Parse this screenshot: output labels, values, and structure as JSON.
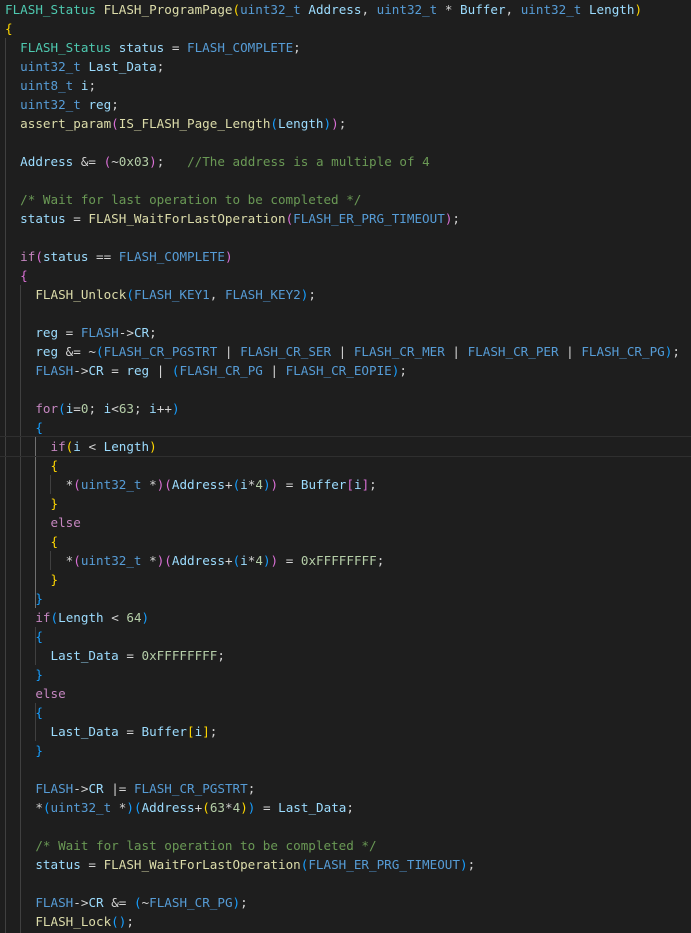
{
  "editor": {
    "theme": "dark",
    "background": "#1e1e1e",
    "current_line": 23,
    "colors": {
      "type": "#4ec9b0",
      "function": "#dcdcaa",
      "variable": "#9cdcfe",
      "keyword": "#c586c0",
      "macro": "#569cd6",
      "number": "#b5cea8",
      "comment": "#6a9955",
      "bracket_1": "#ffd700",
      "bracket_2": "#da70d6",
      "bracket_3": "#179fff"
    }
  },
  "lines": [
    [
      [
        "FLASH_Status",
        "type"
      ],
      [
        " ",
        ""
      ],
      [
        "FLASH_ProgramPage",
        "fn"
      ],
      [
        "(",
        "b1"
      ],
      [
        "uint32_t",
        "mac"
      ],
      [
        " ",
        ""
      ],
      [
        "Address",
        "var"
      ],
      [
        ", ",
        ""
      ],
      [
        "uint32_t",
        "mac"
      ],
      [
        " * ",
        ""
      ],
      [
        "Buffer",
        "var"
      ],
      [
        ", ",
        ""
      ],
      [
        "uint32_t",
        "mac"
      ],
      [
        " ",
        ""
      ],
      [
        "Length",
        "var"
      ],
      [
        ")",
        "b1"
      ]
    ],
    [
      [
        "{",
        "b1"
      ]
    ],
    [
      [
        "  ",
        ""
      ],
      [
        "FLASH_Status",
        "type"
      ],
      [
        " ",
        ""
      ],
      [
        "status",
        "var"
      ],
      [
        " = ",
        ""
      ],
      [
        "FLASH_COMPLETE",
        "mac"
      ],
      [
        ";",
        ""
      ]
    ],
    [
      [
        "  ",
        ""
      ],
      [
        "uint32_t",
        "mac"
      ],
      [
        " ",
        ""
      ],
      [
        "Last_Data",
        "var"
      ],
      [
        ";",
        ""
      ]
    ],
    [
      [
        "  ",
        ""
      ],
      [
        "uint8_t",
        "mac"
      ],
      [
        " ",
        ""
      ],
      [
        "i",
        "var"
      ],
      [
        ";",
        ""
      ]
    ],
    [
      [
        "  ",
        ""
      ],
      [
        "uint32_t",
        "mac"
      ],
      [
        " ",
        ""
      ],
      [
        "reg",
        "var"
      ],
      [
        ";",
        ""
      ]
    ],
    [
      [
        "  ",
        ""
      ],
      [
        "assert_param",
        "fn"
      ],
      [
        "(",
        "b2"
      ],
      [
        "IS_FLASH_Page_Length",
        "fn"
      ],
      [
        "(",
        "b3"
      ],
      [
        "Length",
        "var"
      ],
      [
        ")",
        "b3"
      ],
      [
        ")",
        "b2"
      ],
      [
        ";",
        ""
      ]
    ],
    [],
    [
      [
        "  ",
        ""
      ],
      [
        "Address",
        "var"
      ],
      [
        " &= ",
        ""
      ],
      [
        "(",
        "b2"
      ],
      [
        "~",
        "op"
      ],
      [
        "0x03",
        "num"
      ],
      [
        ")",
        "b2"
      ],
      [
        ";   ",
        ""
      ],
      [
        "//The address is a multiple of 4",
        "com"
      ]
    ],
    [],
    [
      [
        "  ",
        ""
      ],
      [
        "/* Wait for last operation to be completed */",
        "com"
      ]
    ],
    [
      [
        "  ",
        ""
      ],
      [
        "status",
        "var"
      ],
      [
        " = ",
        ""
      ],
      [
        "FLASH_WaitForLastOperation",
        "fn"
      ],
      [
        "(",
        "b2"
      ],
      [
        "FLASH_ER_PRG_TIMEOUT",
        "mac"
      ],
      [
        ")",
        "b2"
      ],
      [
        ";",
        ""
      ]
    ],
    [],
    [
      [
        "  ",
        ""
      ],
      [
        "if",
        "kw"
      ],
      [
        "(",
        "b2"
      ],
      [
        "status",
        "var"
      ],
      [
        " == ",
        ""
      ],
      [
        "FLASH_COMPLETE",
        "mac"
      ],
      [
        ")",
        "b2"
      ]
    ],
    [
      [
        "  ",
        ""
      ],
      [
        "{",
        "b2"
      ]
    ],
    [
      [
        "    ",
        ""
      ],
      [
        "FLASH_Unlock",
        "fn"
      ],
      [
        "(",
        "b3"
      ],
      [
        "FLASH_KEY1",
        "mac"
      ],
      [
        ", ",
        ""
      ],
      [
        "FLASH_KEY2",
        "mac"
      ],
      [
        ")",
        "b3"
      ],
      [
        ";",
        ""
      ]
    ],
    [],
    [
      [
        "    ",
        ""
      ],
      [
        "reg",
        "var"
      ],
      [
        " = ",
        ""
      ],
      [
        "FLASH",
        "mac"
      ],
      [
        "->",
        "op"
      ],
      [
        "CR",
        "var"
      ],
      [
        ";",
        ""
      ]
    ],
    [
      [
        "    ",
        ""
      ],
      [
        "reg",
        "var"
      ],
      [
        " &= ~",
        ""
      ],
      [
        "(",
        "b3"
      ],
      [
        "FLASH_CR_PGSTRT",
        "mac"
      ],
      [
        " | ",
        ""
      ],
      [
        "FLASH_CR_SER",
        "mac"
      ],
      [
        " | ",
        ""
      ],
      [
        "FLASH_CR_MER",
        "mac"
      ],
      [
        " | ",
        ""
      ],
      [
        "FLASH_CR_PER",
        "mac"
      ],
      [
        " | ",
        ""
      ],
      [
        "FLASH_CR_PG",
        "mac"
      ],
      [
        ")",
        "b3"
      ],
      [
        ";",
        ""
      ]
    ],
    [
      [
        "    ",
        ""
      ],
      [
        "FLASH",
        "mac"
      ],
      [
        "->",
        "op"
      ],
      [
        "CR",
        "var"
      ],
      [
        " = ",
        ""
      ],
      [
        "reg",
        "var"
      ],
      [
        " | ",
        ""
      ],
      [
        "(",
        "b3"
      ],
      [
        "FLASH_CR_PG",
        "mac"
      ],
      [
        " | ",
        ""
      ],
      [
        "FLASH_CR_EOPIE",
        "mac"
      ],
      [
        ")",
        "b3"
      ],
      [
        ";",
        ""
      ]
    ],
    [],
    [
      [
        "    ",
        ""
      ],
      [
        "for",
        "kw"
      ],
      [
        "(",
        "b3"
      ],
      [
        "i",
        "var"
      ],
      [
        "=",
        ""
      ],
      [
        "0",
        "num"
      ],
      [
        "; ",
        ""
      ],
      [
        "i",
        "var"
      ],
      [
        "<",
        ""
      ],
      [
        "63",
        "num"
      ],
      [
        "; ",
        ""
      ],
      [
        "i",
        "var"
      ],
      [
        "++",
        ""
      ],
      [
        ")",
        "b3"
      ]
    ],
    [
      [
        "    ",
        ""
      ],
      [
        "{",
        "b3"
      ]
    ],
    [
      [
        "      ",
        ""
      ],
      [
        "if",
        "kw"
      ],
      [
        "(",
        "b1"
      ],
      [
        "i",
        "var"
      ],
      [
        " < ",
        ""
      ],
      [
        "Length",
        "var"
      ],
      [
        ")",
        "b1"
      ]
    ],
    [
      [
        "      ",
        ""
      ],
      [
        "{",
        "b1"
      ]
    ],
    [
      [
        "        ",
        ""
      ],
      [
        "*",
        "op"
      ],
      [
        "(",
        "b2"
      ],
      [
        "uint32_t",
        "mac"
      ],
      [
        " *",
        ""
      ],
      [
        ")",
        "b2"
      ],
      [
        "(",
        "b2"
      ],
      [
        "Address",
        "var"
      ],
      [
        "+",
        ""
      ],
      [
        "(",
        "b3"
      ],
      [
        "i",
        "var"
      ],
      [
        "*",
        ""
      ],
      [
        "4",
        "num"
      ],
      [
        ")",
        "b3"
      ],
      [
        ")",
        "b2"
      ],
      [
        " = ",
        ""
      ],
      [
        "Buffer",
        "var"
      ],
      [
        "[",
        "b2"
      ],
      [
        "i",
        "var"
      ],
      [
        "]",
        "b2"
      ],
      [
        ";",
        ""
      ]
    ],
    [
      [
        "      ",
        ""
      ],
      [
        "}",
        "b1"
      ]
    ],
    [
      [
        "      ",
        ""
      ],
      [
        "else",
        "kw"
      ]
    ],
    [
      [
        "      ",
        ""
      ],
      [
        "{",
        "b1"
      ]
    ],
    [
      [
        "        ",
        ""
      ],
      [
        "*",
        "op"
      ],
      [
        "(",
        "b2"
      ],
      [
        "uint32_t",
        "mac"
      ],
      [
        " *",
        ""
      ],
      [
        ")",
        "b2"
      ],
      [
        "(",
        "b2"
      ],
      [
        "Address",
        "var"
      ],
      [
        "+",
        ""
      ],
      [
        "(",
        "b3"
      ],
      [
        "i",
        "var"
      ],
      [
        "*",
        ""
      ],
      [
        "4",
        "num"
      ],
      [
        ")",
        "b3"
      ],
      [
        ")",
        "b2"
      ],
      [
        " = ",
        ""
      ],
      [
        "0xFFFFFFFF",
        "num"
      ],
      [
        ";",
        ""
      ]
    ],
    [
      [
        "      ",
        ""
      ],
      [
        "}",
        "b1"
      ]
    ],
    [
      [
        "    ",
        ""
      ],
      [
        "}",
        "b3"
      ]
    ],
    [
      [
        "    ",
        ""
      ],
      [
        "if",
        "kw"
      ],
      [
        "(",
        "b3"
      ],
      [
        "Length",
        "var"
      ],
      [
        " < ",
        ""
      ],
      [
        "64",
        "num"
      ],
      [
        ")",
        "b3"
      ]
    ],
    [
      [
        "    ",
        ""
      ],
      [
        "{",
        "b3"
      ]
    ],
    [
      [
        "      ",
        ""
      ],
      [
        "Last_Data",
        "var"
      ],
      [
        " = ",
        ""
      ],
      [
        "0xFFFFFFFF",
        "num"
      ],
      [
        ";",
        ""
      ]
    ],
    [
      [
        "    ",
        ""
      ],
      [
        "}",
        "b3"
      ]
    ],
    [
      [
        "    ",
        ""
      ],
      [
        "else",
        "kw"
      ]
    ],
    [
      [
        "    ",
        ""
      ],
      [
        "{",
        "b3"
      ]
    ],
    [
      [
        "      ",
        ""
      ],
      [
        "Last_Data",
        "var"
      ],
      [
        " = ",
        ""
      ],
      [
        "Buffer",
        "var"
      ],
      [
        "[",
        "b1"
      ],
      [
        "i",
        "var"
      ],
      [
        "]",
        "b1"
      ],
      [
        ";",
        ""
      ]
    ],
    [
      [
        "    ",
        ""
      ],
      [
        "}",
        "b3"
      ]
    ],
    [],
    [
      [
        "    ",
        ""
      ],
      [
        "FLASH",
        "mac"
      ],
      [
        "->",
        "op"
      ],
      [
        "CR",
        "var"
      ],
      [
        " |= ",
        ""
      ],
      [
        "FLASH_CR_PGSTRT",
        "mac"
      ],
      [
        ";",
        ""
      ]
    ],
    [
      [
        "    ",
        ""
      ],
      [
        "*",
        "op"
      ],
      [
        "(",
        "b3"
      ],
      [
        "uint32_t",
        "mac"
      ],
      [
        " *",
        ""
      ],
      [
        ")",
        "b3"
      ],
      [
        "(",
        "b3"
      ],
      [
        "Address",
        "var"
      ],
      [
        "+",
        ""
      ],
      [
        "(",
        "b1"
      ],
      [
        "63",
        "num"
      ],
      [
        "*",
        ""
      ],
      [
        "4",
        "num"
      ],
      [
        ")",
        "b1"
      ],
      [
        ")",
        "b3"
      ],
      [
        " = ",
        ""
      ],
      [
        "Last_Data",
        "var"
      ],
      [
        ";",
        ""
      ]
    ],
    [],
    [
      [
        "    ",
        ""
      ],
      [
        "/* Wait for last operation to be completed */",
        "com"
      ]
    ],
    [
      [
        "    ",
        ""
      ],
      [
        "status",
        "var"
      ],
      [
        " = ",
        ""
      ],
      [
        "FLASH_WaitForLastOperation",
        "fn"
      ],
      [
        "(",
        "b3"
      ],
      [
        "FLASH_ER_PRG_TIMEOUT",
        "mac"
      ],
      [
        ")",
        "b3"
      ],
      [
        ";",
        ""
      ]
    ],
    [],
    [
      [
        "    ",
        ""
      ],
      [
        "FLASH",
        "mac"
      ],
      [
        "->",
        "op"
      ],
      [
        "CR",
        "var"
      ],
      [
        " &= ",
        ""
      ],
      [
        "(",
        "b3"
      ],
      [
        "~",
        "op"
      ],
      [
        "FLASH_CR_PG",
        "mac"
      ],
      [
        ")",
        "b3"
      ],
      [
        ";",
        ""
      ]
    ],
    [
      [
        "    ",
        ""
      ],
      [
        "FLASH_Lock",
        "fn"
      ],
      [
        "(",
        "b3"
      ],
      [
        ")",
        "b3"
      ],
      [
        ";",
        ""
      ]
    ]
  ]
}
